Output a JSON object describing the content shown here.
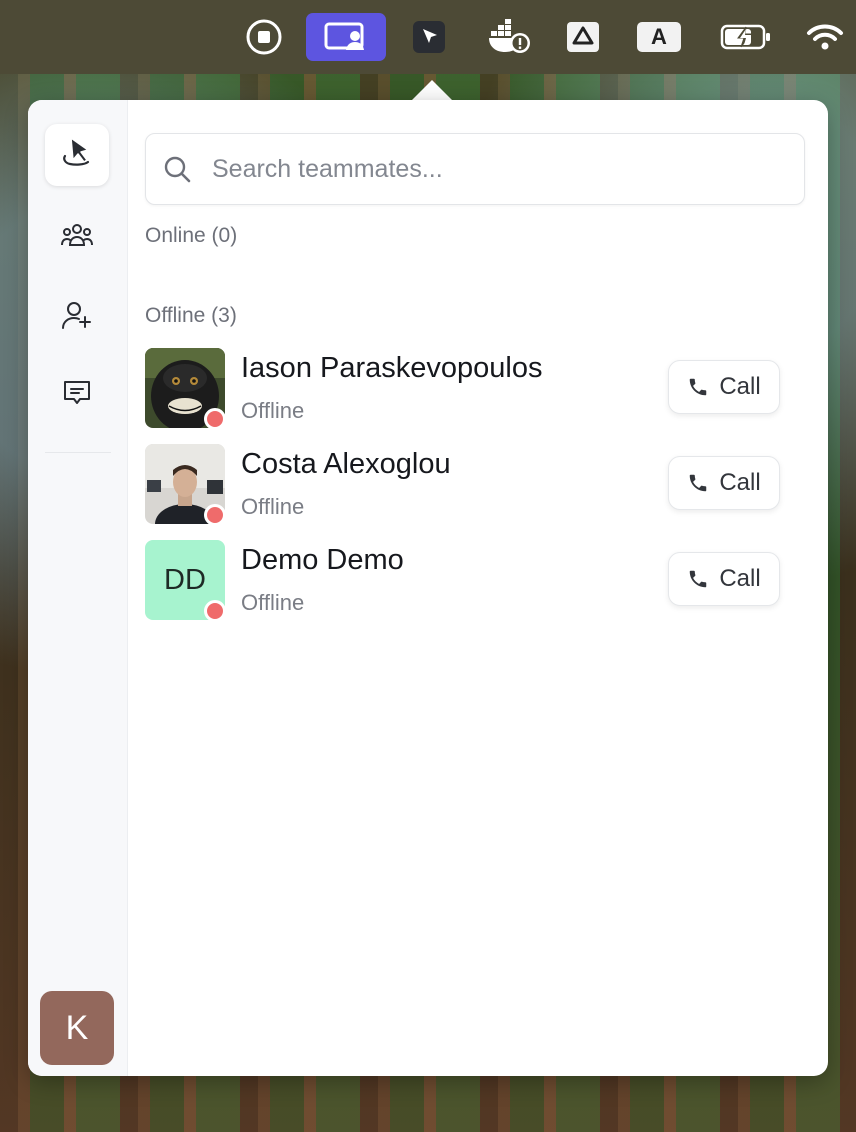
{
  "menubar": {
    "icons": [
      "screen-record-icon",
      "screen-share-app-icon",
      "cursor-app-icon",
      "docker-warning-icon",
      "drive-icon",
      "input-source-icon",
      "battery-charging-icon",
      "wifi-icon"
    ],
    "input_source_letter": "A",
    "accent_color": "#5d55e0"
  },
  "sidebar": {
    "items": [
      {
        "name": "pointer",
        "icon": "pointer-icon",
        "active": true
      },
      {
        "name": "teams",
        "icon": "team-icon",
        "active": false
      },
      {
        "name": "add-teammate",
        "icon": "add-user-icon",
        "active": false
      },
      {
        "name": "messages",
        "icon": "message-icon",
        "active": false
      }
    ],
    "user_initial": "K",
    "user_avatar_color": "#93685c"
  },
  "search": {
    "placeholder": "Search teammates..."
  },
  "sections": {
    "online": {
      "label": "Online (0)"
    },
    "offline": {
      "label": "Offline (3)"
    }
  },
  "members": [
    {
      "name": "Iason Paraskevopoulos",
      "status": "Offline",
      "avatar": "photo",
      "call_label": "Call"
    },
    {
      "name": "Costa Alexoglou",
      "status": "Offline",
      "avatar": "photo",
      "call_label": "Call"
    },
    {
      "name": "Demo Demo",
      "status": "Offline",
      "initials": "DD",
      "avatar_color": "#a7f3cf",
      "call_label": "Call"
    }
  ],
  "status_color_offline": "#ef6b6b"
}
